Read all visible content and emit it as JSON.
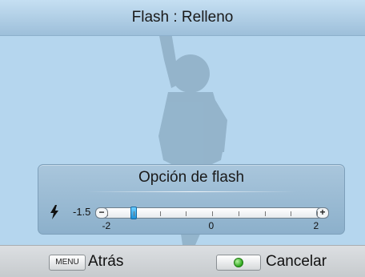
{
  "header": {
    "title": "Flash : Relleno"
  },
  "panel": {
    "title": "Opción de flash",
    "icon": "flash-bolt-icon",
    "current_value_label": "-1.5",
    "slider": {
      "min": -2,
      "max": 2,
      "value": -1.5,
      "scale_labels": [
        "-2",
        "0",
        "2"
      ],
      "minus_label": "−",
      "plus_label": "+"
    }
  },
  "footer": {
    "menu_key": "MENU",
    "back_label": "Atrás",
    "ok_key_icon": "green-ok-icon",
    "cancel_label": "Cancelar"
  },
  "colors": {
    "background": "#b5d6ee",
    "thumb": "#1c8fd6",
    "ok_dot": "#2ea81c"
  }
}
